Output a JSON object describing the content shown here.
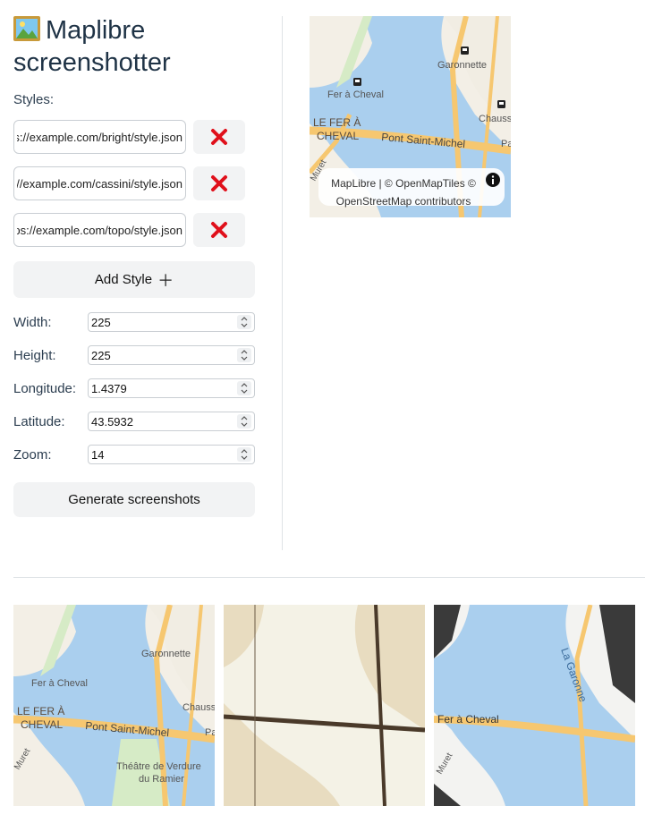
{
  "app": {
    "title": "Maplibre screenshotter",
    "title_icon": "framed-picture-icon"
  },
  "styles": {
    "label": "Styles:",
    "urls": [
      "https://example.com/bright/style.json",
      "https://example.com/cassini/style.json",
      "https://example.com/topo/style.json"
    ],
    "remove_icon": "red-x-icon",
    "add_label": "Add Style",
    "add_icon": "plus-icon"
  },
  "fields": {
    "width": {
      "label": "Width:",
      "value": "225"
    },
    "height": {
      "label": "Height:",
      "value": "225"
    },
    "longitude": {
      "label": "Longitude:",
      "value": "1.4379"
    },
    "latitude": {
      "label": "Latitude:",
      "value": "43.5932"
    },
    "zoom": {
      "label": "Zoom:",
      "value": "14"
    }
  },
  "generate_label": "Generate screenshots",
  "preview": {
    "attribution": "MapLibre | © OpenMapTiles © OpenStreetMap contributors",
    "labels": {
      "garonnette": "Garonnette",
      "fer_a_cheval": "Fer à Cheval",
      "chauss": "Chauss",
      "le_fer_a": "LE FER À",
      "cheval": "CHEVAL",
      "pont": "Pont Saint-Michel",
      "pa": "Pa",
      "muret": "Muret"
    }
  },
  "screenshots": {
    "bright": {
      "garonnette": "Garonnette",
      "fer_a_cheval": "Fer à Cheval",
      "chauss": "Chauss",
      "le_fer_a": "LE FER À",
      "cheval": "CHEVAL",
      "pont": "Pont Saint-Michel",
      "pa": "Pa",
      "muret": "Muret",
      "theatre1": "Théâtre de Verdure",
      "theatre2": "du Ramier"
    },
    "topo": {
      "garonne": "La Garonne",
      "fer_a_cheval": "Fer à Cheval",
      "muret": "Muret"
    }
  },
  "colors": {
    "water": "#aacfee",
    "land": "#f3efe6",
    "road": "#f6c770",
    "park": "#d6ebc6",
    "remove_red": "#e0101b"
  }
}
